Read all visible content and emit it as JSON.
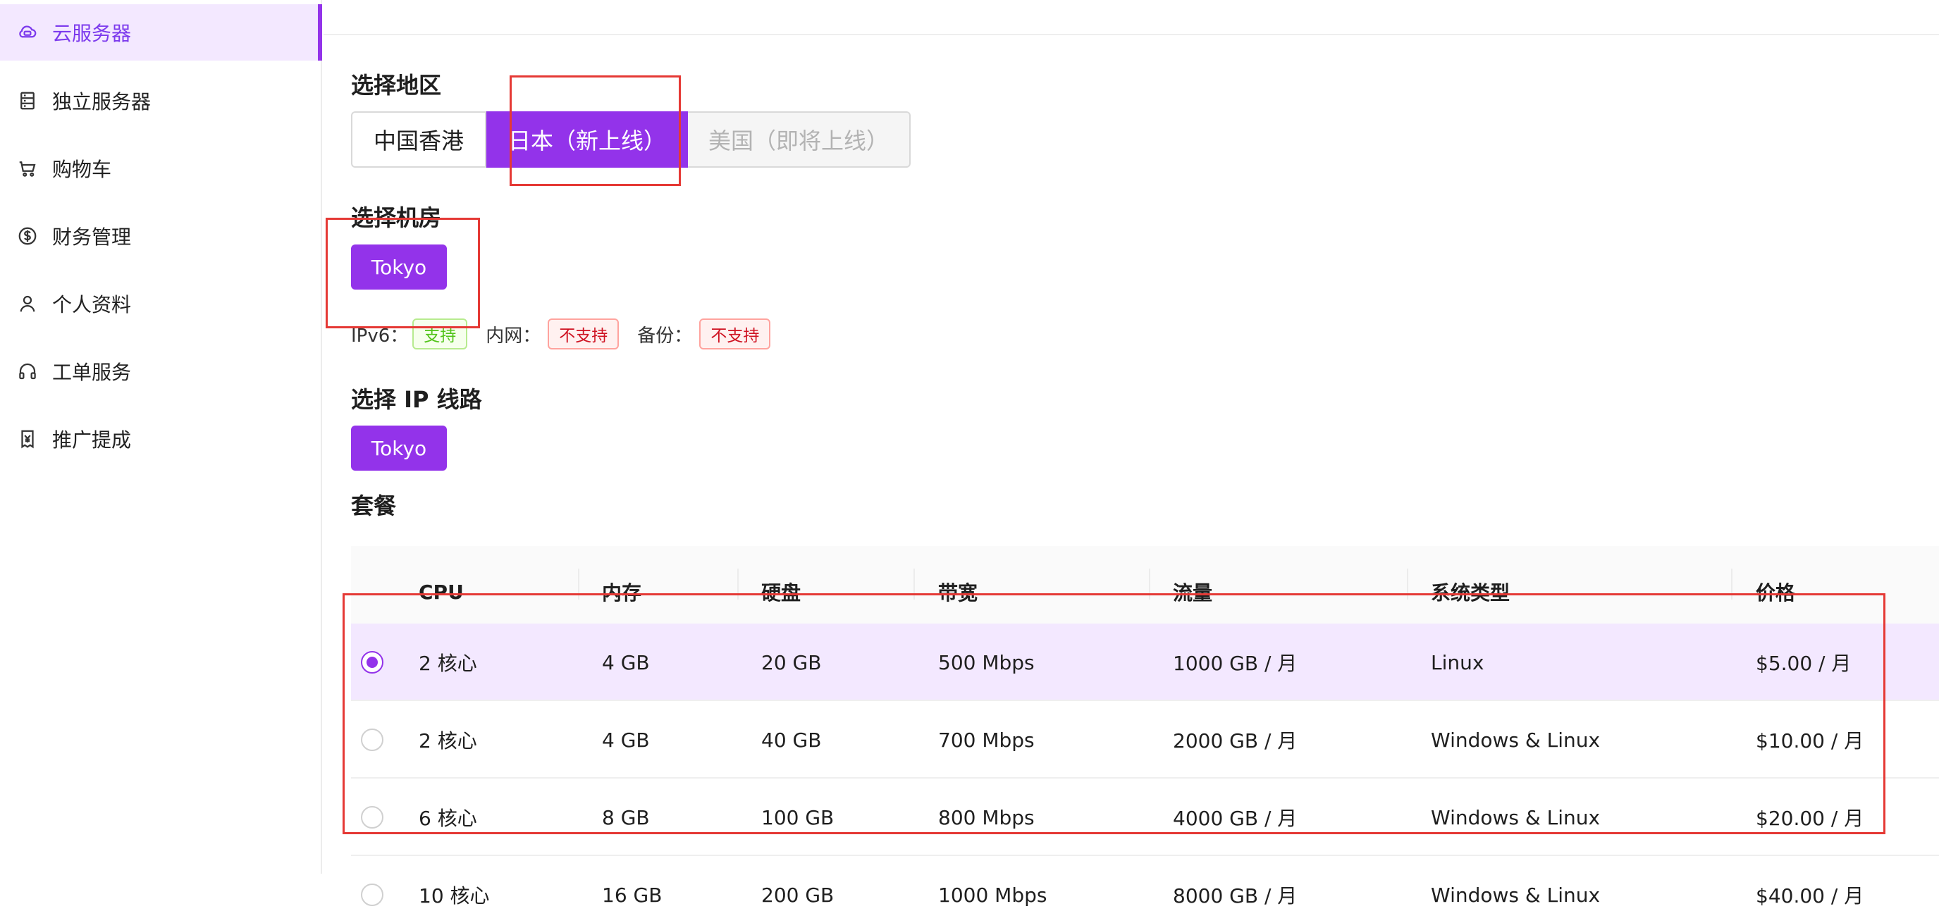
{
  "sidebar": {
    "items": [
      {
        "label": "云服务器",
        "icon": "cloud-server-icon",
        "active": true
      },
      {
        "label": "独立服务器",
        "icon": "server-rack-icon",
        "active": false
      },
      {
        "label": "购物车",
        "icon": "cart-icon",
        "active": false
      },
      {
        "label": "财务管理",
        "icon": "dollar-circle-icon",
        "active": false
      },
      {
        "label": "个人资料",
        "icon": "user-icon",
        "active": false
      },
      {
        "label": "工单服务",
        "icon": "headset-icon",
        "active": false
      },
      {
        "label": "推广提成",
        "icon": "yen-voucher-icon",
        "active": false
      }
    ]
  },
  "region": {
    "title": "选择地区",
    "options": [
      "中国香港",
      "日本（新上线）",
      "美国（即将上线）"
    ],
    "selected": "日本（新上线）",
    "disabled": "美国（即将上线）"
  },
  "datacenter": {
    "title": "选择机房",
    "button": "Tokyo"
  },
  "features": {
    "ipv6_label": "IPv6：",
    "ipv6_value": "支持",
    "intranet_label": "内网：",
    "intranet_value": "不支持",
    "backup_label": "备份：",
    "backup_value": "不支持"
  },
  "ip_line": {
    "title": "选择 IP 线路",
    "button": "Tokyo"
  },
  "plans": {
    "title": "套餐",
    "columns": [
      "CPU",
      "内存",
      "硬盘",
      "带宽",
      "流量",
      "系统类型",
      "价格"
    ],
    "rows": [
      {
        "cpu": "2 核心",
        "memory": "4 GB",
        "disk": "20 GB",
        "bandwidth": "500 Mbps",
        "traffic": "1000 GB / 月",
        "os": "Linux",
        "price": "$5.00 / 月",
        "selected": true
      },
      {
        "cpu": "2 核心",
        "memory": "4 GB",
        "disk": "40 GB",
        "bandwidth": "700 Mbps",
        "traffic": "2000 GB / 月",
        "os": "Windows & Linux",
        "price": "$10.00 / 月",
        "selected": false
      },
      {
        "cpu": "6 核心",
        "memory": "8 GB",
        "disk": "100 GB",
        "bandwidth": "800 Mbps",
        "traffic": "4000 GB / 月",
        "os": "Windows & Linux",
        "price": "$20.00 / 月",
        "selected": false
      },
      {
        "cpu": "10 核心",
        "memory": "16 GB",
        "disk": "200 GB",
        "bandwidth": "1000 Mbps",
        "traffic": "8000 GB / 月",
        "os": "Windows & Linux",
        "price": "$40.00 / 月",
        "selected": false
      }
    ]
  },
  "colors": {
    "accent": "#9333ea",
    "selected_bg": "#f3e8ff",
    "annotation": "#e53935"
  }
}
